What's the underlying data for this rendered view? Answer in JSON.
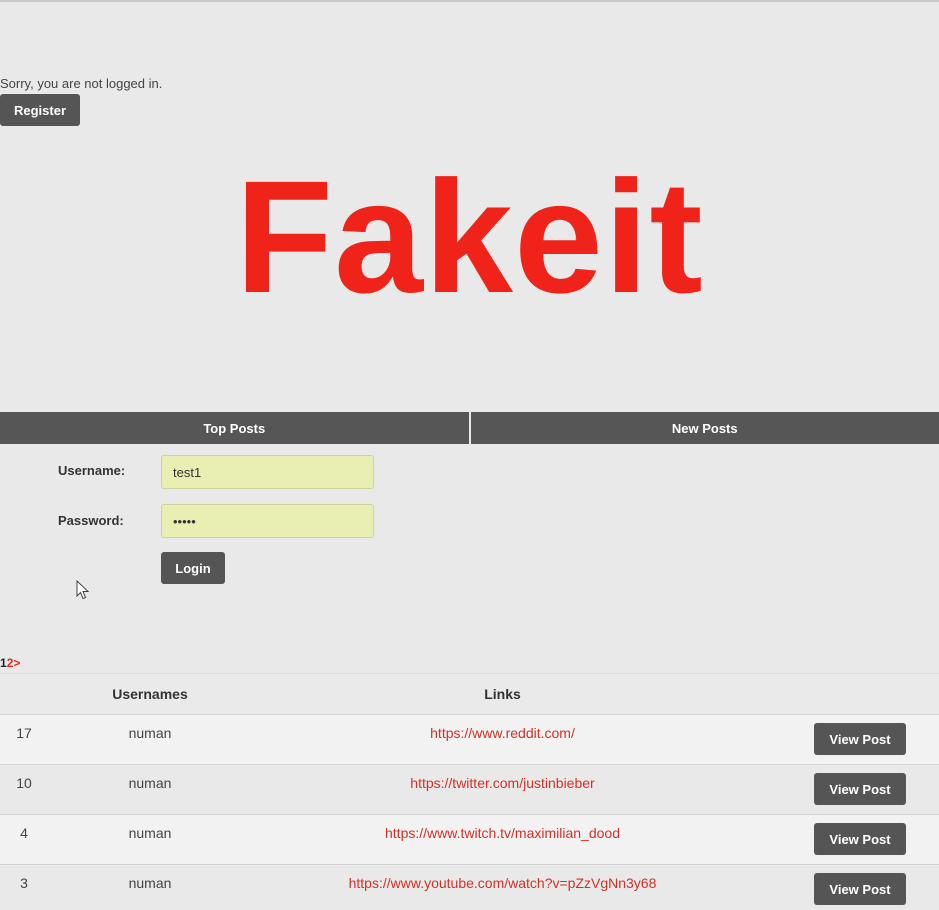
{
  "auth": {
    "notice": "Sorry, you are not logged in.",
    "register_label": "Register"
  },
  "logo": {
    "text": "Fakeit",
    "color": "#f0231a"
  },
  "tabs": [
    {
      "label": "Top Posts"
    },
    {
      "label": "New Posts"
    }
  ],
  "login_form": {
    "username_label": "Username:",
    "username_value": "test1",
    "password_label": "Password:",
    "password_value": "•••••",
    "login_label": "Login"
  },
  "pagination": {
    "current": "1",
    "next": "2",
    "next_arrow": ">"
  },
  "table": {
    "headers": {
      "usernames": "Usernames",
      "links": "Links"
    },
    "rows": [
      {
        "id": "17",
        "username": "numan",
        "link": "https://www.reddit.com/",
        "button": "View Post"
      },
      {
        "id": "10",
        "username": "numan",
        "link": "https://twitter.com/justinbieber",
        "button": "View Post"
      },
      {
        "id": "4",
        "username": "numan",
        "link": "https://www.twitch.tv/maximilian_dood",
        "button": "View Post"
      },
      {
        "id": "3",
        "username": "numan",
        "link": "https://www.youtube.com/watch?v=pZzVgNn3y68",
        "button": "View Post"
      }
    ]
  }
}
